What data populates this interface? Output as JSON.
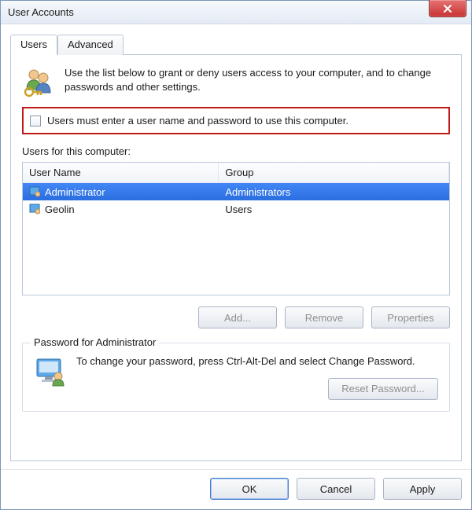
{
  "window": {
    "title": "User Accounts"
  },
  "tabs": {
    "users": "Users",
    "advanced": "Advanced"
  },
  "intro": {
    "text": "Use the list below to grant or deny users access to your computer, and to change passwords and other settings."
  },
  "checkbox": {
    "label": "Users must enter a user name and password to use this computer.",
    "checked": false
  },
  "usersList": {
    "label": "Users for this computer:",
    "columns": {
      "user": "User Name",
      "group": "Group"
    },
    "rows": [
      {
        "user": "Administrator",
        "group": "Administrators",
        "selected": true
      },
      {
        "user": "Geolin",
        "group": "Users",
        "selected": false
      }
    ]
  },
  "listButtons": {
    "add": "Add...",
    "remove": "Remove",
    "properties": "Properties"
  },
  "passwordBox": {
    "legend": "Password for Administrator",
    "text": "To change your password, press Ctrl-Alt-Del and select Change Password.",
    "reset": "Reset Password..."
  },
  "dialogButtons": {
    "ok": "OK",
    "cancel": "Cancel",
    "apply": "Apply"
  }
}
